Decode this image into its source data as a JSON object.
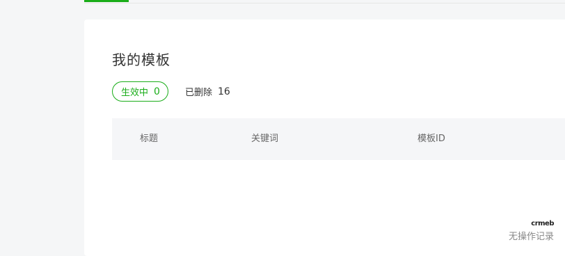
{
  "page": {
    "title": "我的模板"
  },
  "tabs": [
    {
      "label": "生效中",
      "count": "0"
    },
    {
      "label": "已删除",
      "count": "16"
    }
  ],
  "table": {
    "columns": [
      "标题",
      "关键词",
      "模板ID"
    ]
  },
  "watermark": {
    "logo": "crmeb",
    "text": "无操作记录"
  },
  "colors": {
    "accent": "#1aad19",
    "background": "#f5f6f7",
    "card": "#ffffff",
    "table_header": "#f5f6f8"
  }
}
